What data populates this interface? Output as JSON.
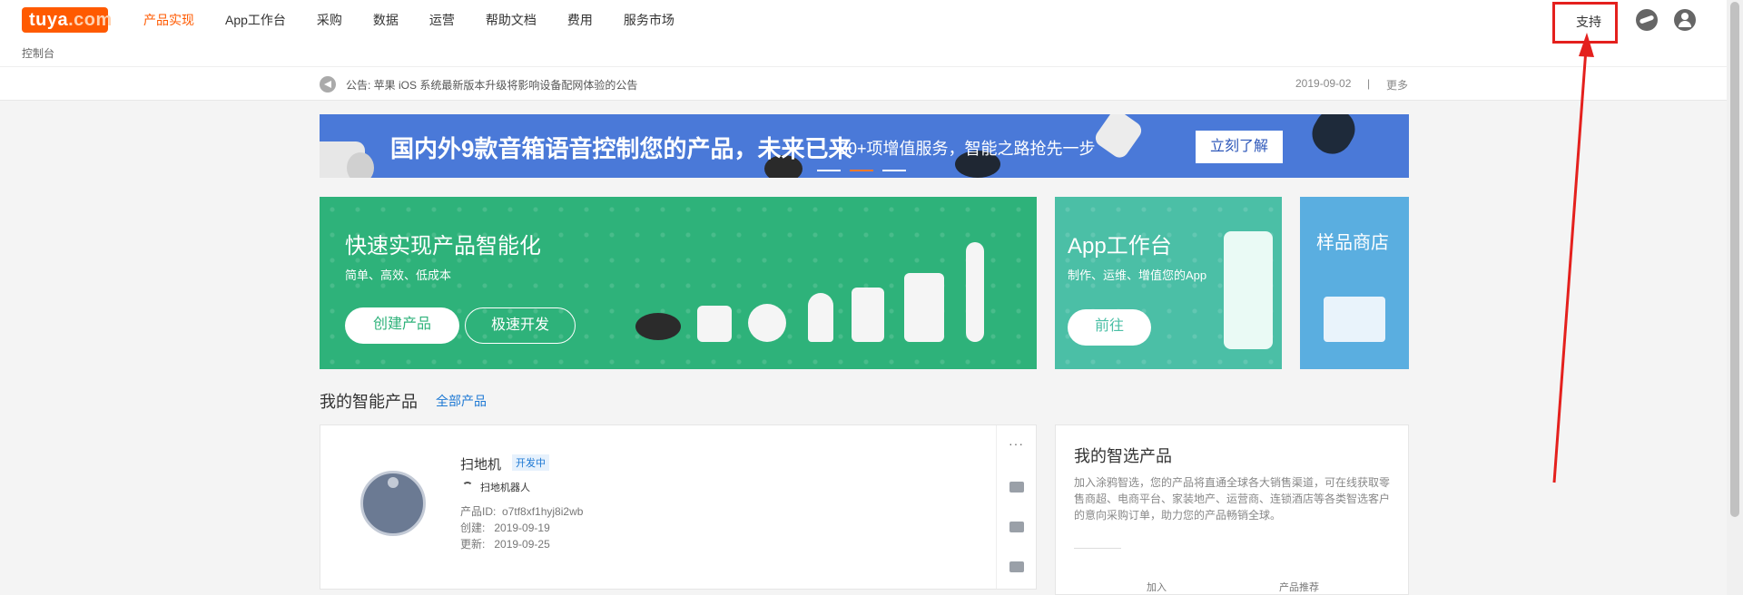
{
  "header": {
    "logo_text": "tuya",
    "logo_suffix": ".com",
    "nav": [
      "产品实现",
      "App工作台",
      "采购",
      "数据",
      "运营",
      "帮助文档",
      "费用",
      "服务市场"
    ],
    "active_nav": "产品实现",
    "breadcrumb": "控制台",
    "support_label": "支持"
  },
  "notice": {
    "text": "公告: 苹果 iOS 系统最新版本升级将影响设备配网体验的公告",
    "date": "2019-09-02",
    "separator": "|",
    "more": "更多"
  },
  "banner": {
    "title": "国内外9款音箱语音控制您的产品，未来已来",
    "subtitle": "30+项增值服务，智能之路抢先一步",
    "button": "立刻了解"
  },
  "cards": {
    "green": {
      "title": "快速实现产品智能化",
      "subtitle": "简单、高效、低成本",
      "btn_primary": "创建产品",
      "btn_secondary": "极速开发"
    },
    "teal": {
      "title": "App工作台",
      "subtitle": "制作、运维、增值您的App",
      "button": "前往"
    },
    "blue": {
      "title": "样品商店"
    }
  },
  "products": {
    "section_title": "我的智能产品",
    "all_link": "全部产品",
    "item": {
      "name": "扫地机",
      "status": "开发中",
      "category": "扫地机器人",
      "id_label": "产品ID:",
      "id_value": "o7tf8xf1hyj8i2wb",
      "created_label": "创建:",
      "created_value": "2019-09-19",
      "updated_label": "更新:",
      "updated_value": "2019-09-25",
      "more_glyph": "···"
    }
  },
  "selected": {
    "title": "我的智选产品",
    "desc": "加入涂鸦智选，您的产品将直通全球各大销售渠道，可在线获取零 售商超、电商平台、家装地产、运营商、连锁酒店等各类智选客户 的意向采购订单，助力您的产品畅销全球。",
    "label_join": "加入",
    "label_recommend": "产品推荐"
  },
  "colors": {
    "brand": "#ff5a00",
    "green_card": "#2eb27a",
    "teal_card": "#4bbfa6",
    "blue_card": "#5aaee0",
    "banner": "#4a79d8",
    "link": "#1e79d4",
    "annotation": "#e4201d"
  }
}
